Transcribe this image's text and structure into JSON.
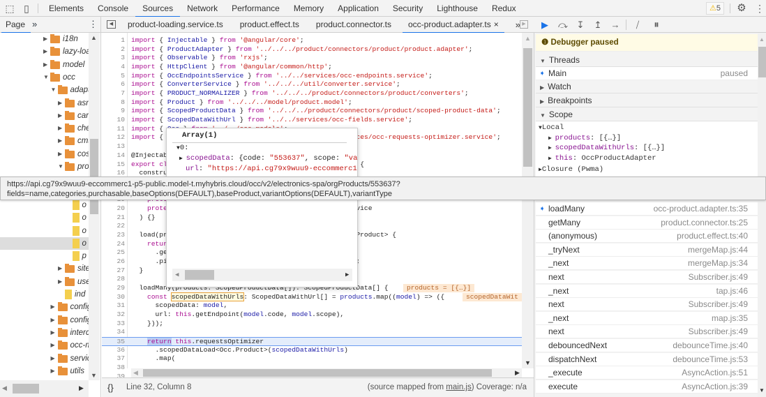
{
  "topbar": {
    "icons": [
      "inspect-element-icon",
      "device-toolbar-icon"
    ],
    "tabs": [
      "Elements",
      "Console",
      "Sources",
      "Network",
      "Performance",
      "Memory",
      "Application",
      "Security",
      "Lighthouse",
      "Redux"
    ],
    "active_tab": "Sources",
    "warning_count": "5",
    "accent": "#1a73e8"
  },
  "navigator": {
    "tab": "Page",
    "more": "»",
    "menu": "⋮",
    "items": [
      {
        "label": "i18n",
        "type": "folder",
        "depth": 0,
        "expanded": false
      },
      {
        "label": "lazy-loa",
        "type": "folder",
        "depth": 0,
        "expanded": false
      },
      {
        "label": "model",
        "type": "folder",
        "depth": 0,
        "expanded": false
      },
      {
        "label": "occ",
        "type": "folder",
        "depth": 0,
        "expanded": true
      },
      {
        "label": "adapt",
        "type": "folder",
        "depth": 1,
        "expanded": true
      },
      {
        "label": "asn",
        "type": "folder",
        "depth": 2,
        "expanded": false
      },
      {
        "label": "carı",
        "type": "folder",
        "depth": 2,
        "expanded": false
      },
      {
        "label": "che",
        "type": "folder",
        "depth": 2,
        "expanded": false
      },
      {
        "label": "cms",
        "type": "folder",
        "depth": 2,
        "expanded": false
      },
      {
        "label": "cos",
        "type": "folder",
        "depth": 2,
        "expanded": false
      },
      {
        "label": "pro",
        "type": "folder",
        "depth": 2,
        "expanded": true
      },
      {
        "label": "",
        "type": "hidden",
        "depth": 3
      },
      {
        "label": "ir",
        "type": "file",
        "depth": 3
      },
      {
        "label": "o",
        "type": "file",
        "depth": 3
      },
      {
        "label": "o",
        "type": "file",
        "depth": 3
      },
      {
        "label": "o",
        "type": "file",
        "depth": 3
      },
      {
        "label": "o",
        "type": "file",
        "depth": 3,
        "selected": true
      },
      {
        "label": "p",
        "type": "file",
        "depth": 3
      },
      {
        "label": "site",
        "type": "folder",
        "depth": 2,
        "expanded": false
      },
      {
        "label": "use",
        "type": "folder",
        "depth": 2,
        "expanded": false
      },
      {
        "label": "ind",
        "type": "file",
        "depth": 2
      },
      {
        "label": "config",
        "type": "folder",
        "depth": 1,
        "expanded": false
      },
      {
        "label": "config",
        "type": "folder",
        "depth": 1,
        "expanded": false
      },
      {
        "label": "interc",
        "type": "folder",
        "depth": 1,
        "expanded": false
      },
      {
        "label": "occ-m",
        "type": "folder",
        "depth": 1,
        "expanded": false
      },
      {
        "label": "servic",
        "type": "folder",
        "depth": 1,
        "expanded": false
      },
      {
        "label": "utils",
        "type": "folder",
        "depth": 1,
        "expanded": false
      }
    ]
  },
  "file_tabs": {
    "tabs": [
      "product-loading.service.ts",
      "product.effect.ts",
      "product.connector.ts",
      "occ-product.adapter.ts"
    ],
    "active": "occ-product.adapter.ts",
    "close": "×",
    "more": "»"
  },
  "editor": {
    "current_line": 35,
    "lines": [
      {
        "n": "1",
        "text": "import { Injectable } from '@angular/core';"
      },
      {
        "n": "2",
        "text": "import { ProductAdapter } from '../../../product/connectors/product/product.adapter';"
      },
      {
        "n": "3",
        "text": "import { Observable } from 'rxjs';"
      },
      {
        "n": "4",
        "text": "import { HttpClient } from '@angular/common/http';"
      },
      {
        "n": "5",
        "text": "import { OccEndpointsService } from '../../services/occ-endpoints.service';"
      },
      {
        "n": "6",
        "text": "import { ConverterService } from '../../../util/converter.service';"
      },
      {
        "n": "7",
        "text": "import { PRODUCT_NORMALIZER } from '../../../product/connectors/product/converters';"
      },
      {
        "n": "8",
        "text": "import { Product } from '../../../model/product.model';"
      },
      {
        "n": "9",
        "text": "import { ScopedProductData } from '../../../product/connectors/product/scoped-product-data';"
      },
      {
        "n": "10",
        "text": "import { ScopedDataWithUrl } from '../../services/occ-fields.service';"
      },
      {
        "n": "11",
        "text": "import { Occ } from '../../occ-models';"
      },
      {
        "n": "12",
        "text": "import { OccRequestsOptimizerService } from '../../services/occ-requests-optimizer.service';"
      },
      {
        "n": "13",
        "text": ""
      },
      {
        "n": "14",
        "text": "@Injectable()"
      },
      {
        "n": "15",
        "text": "export class OccProductAdapter implements ProductAdapter {"
      },
      {
        "n": "16",
        "text": "  constructor("
      },
      {
        "n": "17",
        "text": ""
      },
      {
        "n": "18",
        "text": ""
      },
      {
        "n": "19",
        "text": "    protected"
      },
      {
        "n": "20",
        "text": "    protected requestsOptimizer: OccRequestsOptimizerService"
      },
      {
        "n": "21",
        "text": "  ) {}"
      },
      {
        "n": "22",
        "text": ""
      },
      {
        "n": "23",
        "text": "  load(productCode: string, scope?: string): Observable<Product> {"
      },
      {
        "n": "24",
        "text": "    return"
      },
      {
        "n": "25",
        "text": "      .ge"
      },
      {
        "n": "26",
        "text": "      .pi                                             ));"
      },
      {
        "n": "27",
        "text": "  }"
      },
      {
        "n": "28",
        "text": ""
      },
      {
        "n": "29",
        "text": "  loadMany(products: ScopedProductData[]): ScopedProductData[] {"
      },
      {
        "n": "30",
        "text": "    const scopedDataWithUrls: ScopedDataWithUrl[] = products.map((model) => ({"
      },
      {
        "n": "31",
        "text": "      scopedData: model,"
      },
      {
        "n": "32",
        "text": "      url: this.getEndpoint(model.code, model.scope),"
      },
      {
        "n": "33",
        "text": "    }));"
      },
      {
        "n": "34",
        "text": ""
      },
      {
        "n": "35",
        "text": "    return this.requestsOptimizer"
      },
      {
        "n": "36",
        "text": "      .scopedDataLoad<Occ.Product>(scopedDataWithUrls)"
      },
      {
        "n": "37",
        "text": "      .map("
      },
      {
        "n": "38",
        "text": ""
      },
      {
        "n": "39",
        "text": ""
      }
    ],
    "inline_values": [
      {
        "line": "29",
        "text": "products = [{…}]"
      },
      {
        "line": "30",
        "text": "scopedDataWit"
      }
    ],
    "highlighted_token": "scopedDataWithUrls"
  },
  "popup": {
    "title": "Array(1)",
    "index": "0:",
    "prop1_key": "scopedData",
    "prop1_val_a": ": {code: ",
    "prop1_code": "\"553637\"",
    "prop1_val_b": ", scope: ",
    "prop1_scope": "\"var",
    "prop2_key": "url",
    "prop2_val": "\"https://api.cg79x9wuu9-eccommerc1-"
  },
  "tooltip": {
    "line1": "https://api.cg79x9wuu9-eccommerc1-p5-public.model-t.myhybris.cloud/occ/v2/electronics-spa/orgProducts/553637?",
    "line2": "fields=name,categories,purchasable,baseOptions(DEFAULT),baseProduct,variantOptions(DEFAULT),variantType"
  },
  "status": {
    "format_icon": "{}",
    "position": "Line 32, Column 8",
    "source_prefix": "(source mapped from ",
    "source_link": "main.js",
    "source_suffix": ") Coverage: n/a"
  },
  "debugger": {
    "toolbar": [
      "resume-icon",
      "step-over-icon",
      "step-into-icon",
      "step-out-icon",
      "step-icon",
      "deactivate-breakpoints-icon",
      "pause-on-exceptions-icon"
    ],
    "banner": "Debugger paused",
    "threads": {
      "label": "Threads",
      "main": "Main",
      "status": "paused"
    },
    "watch": "Watch",
    "breakpoints": "Breakpoints",
    "scope": {
      "label": "Scope",
      "local": "Local",
      "vars": [
        {
          "name": "products",
          "value": ": [{…}]"
        },
        {
          "name": "scopedDataWithUrls",
          "value": ": [{…}]"
        },
        {
          "name": "this",
          "value": ": OccProductAdapter"
        }
      ],
      "closure": "Closure (Pwma)"
    },
    "call_stack": [
      {
        "fn": "loadMany",
        "loc": "occ-product.adapter.ts:35",
        "current": true
      },
      {
        "fn": "getMany",
        "loc": "product.connector.ts:25"
      },
      {
        "fn": "(anonymous)",
        "loc": "product.effect.ts:40"
      },
      {
        "fn": "_tryNext",
        "loc": "mergeMap.js:44"
      },
      {
        "fn": "_next",
        "loc": "mergeMap.js:34"
      },
      {
        "fn": "next",
        "loc": "Subscriber.js:49"
      },
      {
        "fn": "_next",
        "loc": "tap.js:46"
      },
      {
        "fn": "next",
        "loc": "Subscriber.js:49"
      },
      {
        "fn": "_next",
        "loc": "map.js:35"
      },
      {
        "fn": "next",
        "loc": "Subscriber.js:49"
      },
      {
        "fn": "debouncedNext",
        "loc": "debounceTime.js:40"
      },
      {
        "fn": "dispatchNext",
        "loc": "debounceTime.js:53"
      },
      {
        "fn": "_execute",
        "loc": "AsyncAction.js:51"
      },
      {
        "fn": "execute",
        "loc": "AsyncAction.js:39"
      }
    ]
  }
}
